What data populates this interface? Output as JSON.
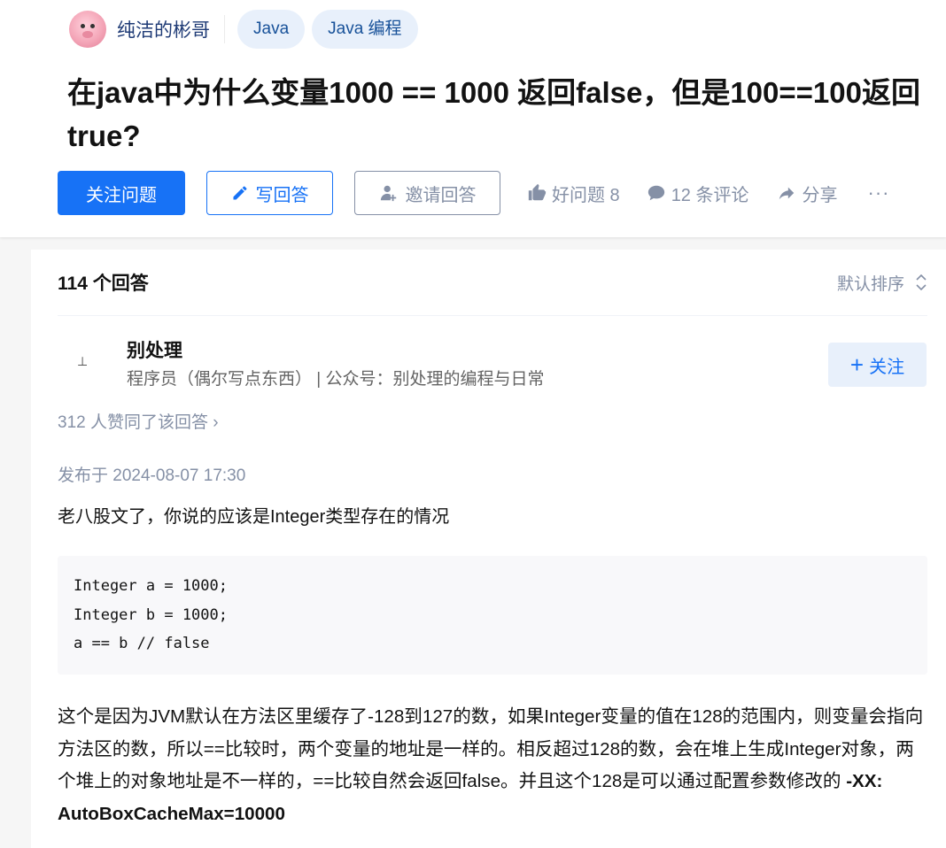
{
  "header": {
    "author_name": "纯洁的彬哥",
    "tags": [
      "Java",
      "Java 编程"
    ],
    "title": "在java中为什么变量1000 == 1000 返回false，但是100==100返回true?",
    "actions": {
      "follow_question": "关注问题",
      "write_answer": "写回答",
      "invite_answer": "邀请回答",
      "good_question": "好问题 8",
      "comments": "12 条评论",
      "share": "分享",
      "more": "···"
    }
  },
  "answers": {
    "count_label": "114 个回答",
    "sort_label": "默认排序",
    "answer": {
      "avatar_glyph": "⊥",
      "author_name": "别处理",
      "author_bio": "程序员（偶尔写点东西） | 公众号：别处理的编程与日常",
      "follow_label": "关注",
      "votes_label": "312 人赞同了该回答 ›",
      "published": "发布于 2024-08-07 17:30",
      "intro": "老八股文了，你说的应该是Integer类型存在的情况",
      "code_lines": [
        "Integer a = 1000;",
        "Integer b = 1000;",
        "a == b // false"
      ],
      "explanation": "这个是因为JVM默认在方法区里缓存了-128到127的数，如果Integer变量的值在128的范围内，则变量会指向方法区的数，所以==比较时，两个变量的地址是一样的。相反超过128的数，会在堆上生成Integer对象，两个堆上的对象地址是不一样的，==比较自然会返回false。并且这个128是可以通过配置参数修改的 ",
      "explanation_bold": "-XX: AutoBoxCacheMax=10000"
    }
  },
  "colors": {
    "primary": "#1772f6",
    "muted": "#8590a6",
    "tag_bg": "#e8f0fb",
    "tag_text": "#175199"
  }
}
